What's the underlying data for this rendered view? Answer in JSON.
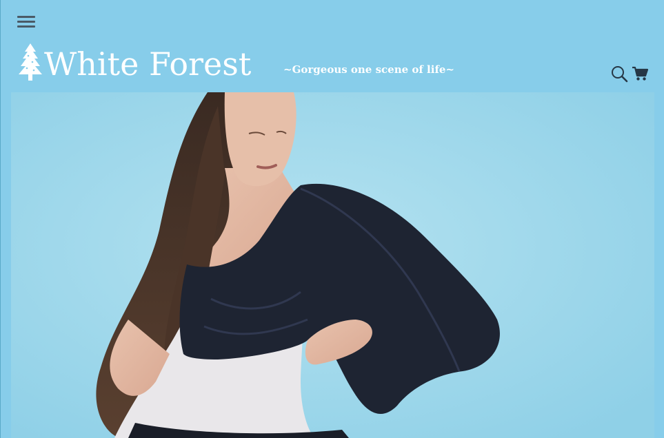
{
  "header": {
    "menu_icon": "hamburger-menu-icon",
    "logo": {
      "icon": "pine-tree-icon",
      "text": "White Forest"
    },
    "tagline": "~Gorgeous one scene of life~",
    "search_icon": "search-icon",
    "cart_icon": "shopping-cart-icon"
  },
  "hero": {
    "image": "model wearing black draped one-shoulder top over white tank on light blue background"
  },
  "colors": {
    "background": "#87cdea",
    "text": "#ffffff",
    "icon": "#263746"
  }
}
